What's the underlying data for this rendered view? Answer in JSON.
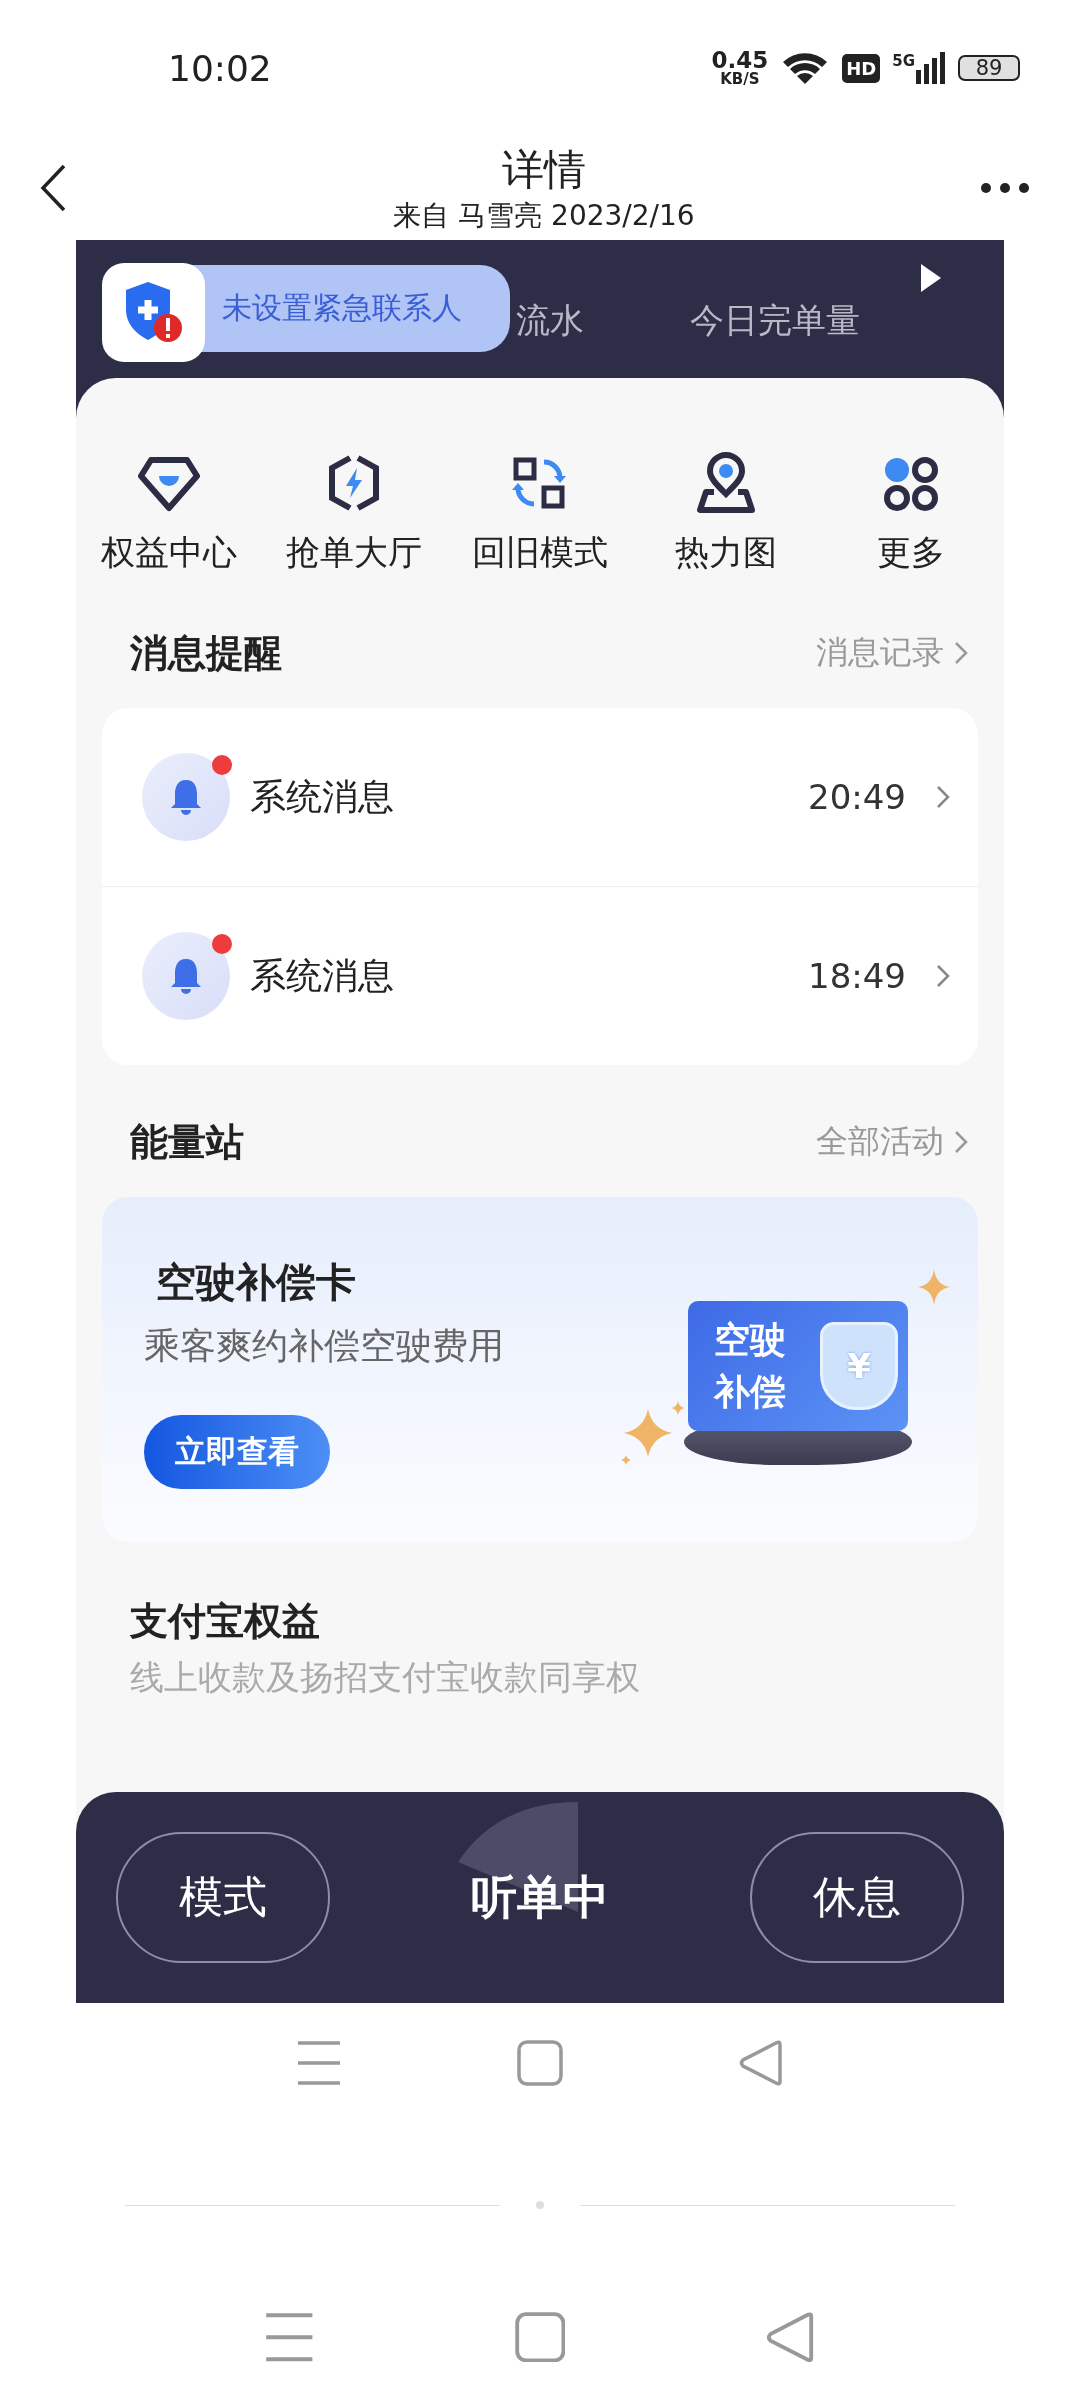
{
  "status_bar": {
    "time": "10:02",
    "net_speed": "0.45",
    "net_unit": "KB/S",
    "hd": "HD",
    "network": "5G",
    "battery": "89"
  },
  "header": {
    "title": "详情",
    "subtitle": "来自 马雪亮 2023/2/16"
  },
  "app": {
    "stats": [
      {
        "label": "流水"
      },
      {
        "label": "今日完单量"
      }
    ],
    "toast": {
      "text": "未设置紧急联系人"
    },
    "shortcuts": [
      {
        "label": "权益中心",
        "kind": "diamond"
      },
      {
        "label": "抢单大厅",
        "kind": "hexagon"
      },
      {
        "label": "回旧模式",
        "kind": "swap"
      },
      {
        "label": "热力图",
        "kind": "pin"
      },
      {
        "label": "更多",
        "kind": "dots"
      }
    ],
    "messages": {
      "title": "消息提醒",
      "link": "消息记录",
      "items": [
        {
          "name": "系统消息",
          "time": "20:49",
          "unread": true
        },
        {
          "name": "系统消息",
          "time": "18:49",
          "unread": true
        }
      ]
    },
    "energy": {
      "title": "能量站",
      "link": "全部活动",
      "banner": {
        "title": "空驶补偿卡",
        "subtitle": "乘客爽约补偿空驶费用",
        "button": "立即查看",
        "card_lines": [
          "空驶",
          "补偿"
        ],
        "shield_symbol": "¥"
      }
    },
    "alipay": {
      "title": "支付宝权益",
      "description": "线上收款及扬招支付宝收款同享权"
    },
    "bottom_bar": {
      "left": "模式",
      "center": "听单中",
      "right": "休息"
    }
  }
}
